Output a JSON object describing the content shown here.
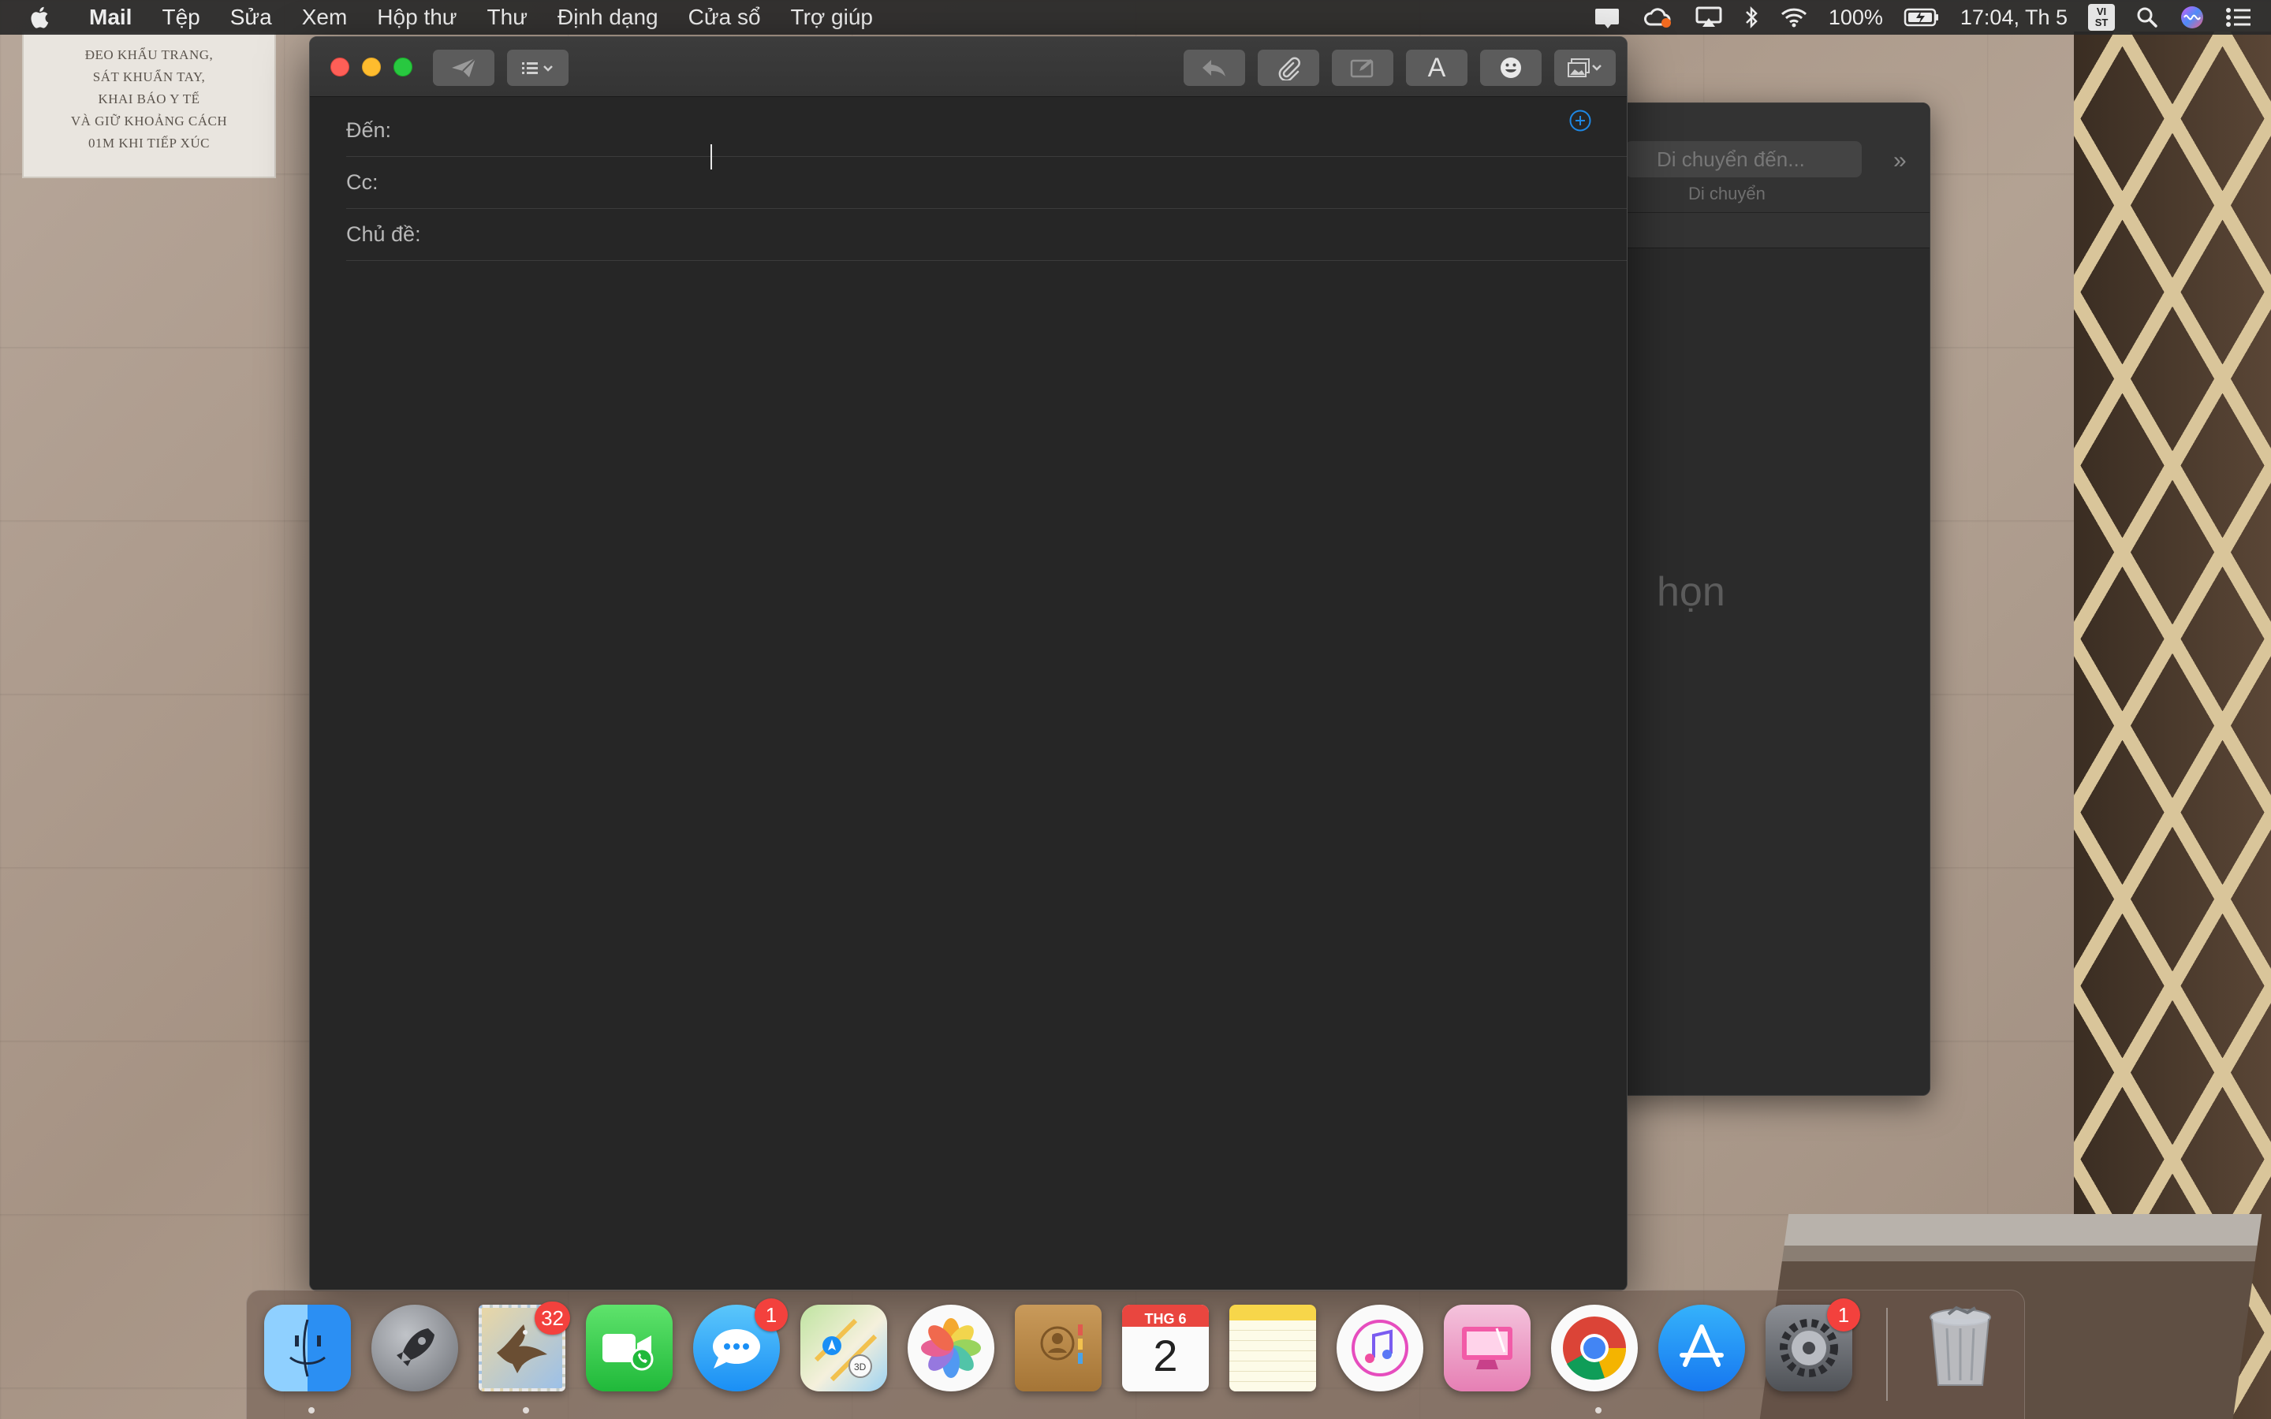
{
  "menubar": {
    "app_name": "Mail",
    "menus": [
      "Tệp",
      "Sửa",
      "Xem",
      "Hộp thư",
      "Thư",
      "Định dạng",
      "Cửa sổ",
      "Trợ giúp"
    ],
    "battery": "100%",
    "clock": "17:04, Th 5",
    "input_method": "VI\nST",
    "icons": [
      "apple-logo",
      "notification-icon",
      "cloud-sync-icon",
      "airplay-icon",
      "bluetooth-icon",
      "wifi-icon",
      "battery-icon",
      "spotlight-icon",
      "siri-icon",
      "notification-center-icon"
    ]
  },
  "wallpaper": {
    "notice_lines": [
      "ĐEO KHẨU TRANG,",
      "SÁT KHUẨN TAY,",
      "KHAI BÁO Y TẾ",
      "VÀ GIỮ KHOẢNG CÁCH",
      "01M KHI TIẾP XÚC"
    ]
  },
  "background_window": {
    "move_placeholder": "Di chuyển đến...",
    "move_label": "Di chuyển",
    "empty_text": "họn"
  },
  "compose": {
    "to_label": "Đến:",
    "cc_label": "Cc:",
    "subject_label": "Chủ đề:",
    "to_value": "",
    "cc_value": "",
    "subject_value": "",
    "toolbar": [
      "send-button",
      "header-fields-button",
      "reply-button",
      "attach-button",
      "markup-button",
      "format-button",
      "emoji-button",
      "photo-browser-button"
    ],
    "format_label": "A"
  },
  "dock": {
    "apps": [
      {
        "name": "Finder",
        "running": true
      },
      {
        "name": "Launchpad",
        "running": false
      },
      {
        "name": "Mail",
        "running": true,
        "badge": "32"
      },
      {
        "name": "FaceTime",
        "running": false
      },
      {
        "name": "Messages",
        "running": false,
        "badge": "1"
      },
      {
        "name": "Maps",
        "running": false
      },
      {
        "name": "Photos",
        "running": false
      },
      {
        "name": "Contacts",
        "running": false
      },
      {
        "name": "Calendar",
        "running": false
      },
      {
        "name": "Notes",
        "running": false
      },
      {
        "name": "iTunes",
        "running": false
      },
      {
        "name": "CleanMyMac",
        "running": false
      },
      {
        "name": "Google Chrome",
        "running": true
      },
      {
        "name": "App Store",
        "running": false
      },
      {
        "name": "System Preferences",
        "running": false,
        "badge": "1"
      },
      {
        "name": "Trash",
        "running": false
      }
    ],
    "calendar_month": "THG 6",
    "calendar_day": "2"
  },
  "colors": {
    "accent": "#1e88e5",
    "badge": "#f3413d",
    "window_bg": "#262626"
  }
}
